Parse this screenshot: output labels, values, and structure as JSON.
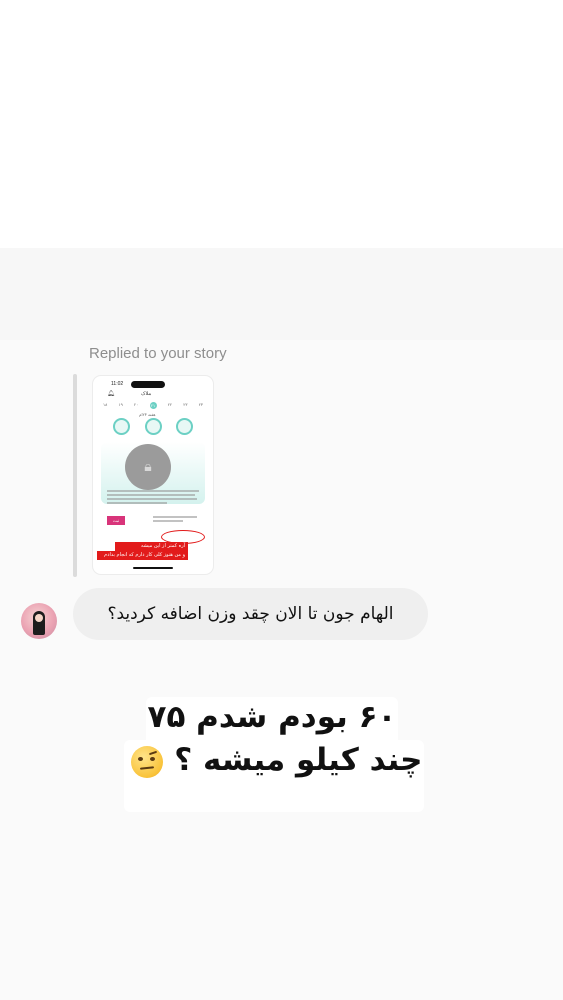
{
  "reply": {
    "label": "Replied to your story"
  },
  "story_thumbnail": {
    "status_time": "11:02",
    "app_title": "ملاک",
    "week_label": "هفته ۲۴ام",
    "day_numbers": [
      "۱۸",
      "۱۹",
      "۲۰",
      "۲۱",
      "۲۲",
      "۲۳",
      "۲۴"
    ],
    "pink_button_label": "ثبت",
    "annotation_1": "آره کمتر از این میشه",
    "annotation_2": "و من هنوز کلی کار دارم که انجام بدادم",
    "colors": {
      "teal": "#6cd0c4",
      "annotation_red": "#e21b1b",
      "pink": "#d8347a"
    }
  },
  "message": {
    "text": "الهام جون تا الان چقد وزن اضافه کردید؟"
  },
  "story_reply_text": {
    "line_1": "۶۰ بودم شدم ۷۵",
    "line_2": "چند کیلو میشه ؟",
    "emoji": "face-with-raised-eyebrow-icon"
  }
}
